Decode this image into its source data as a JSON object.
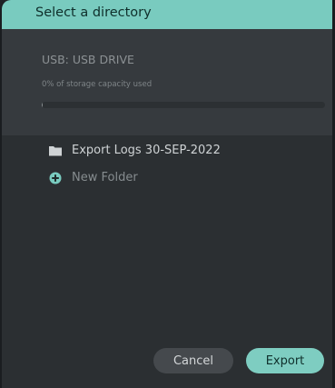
{
  "dialog": {
    "title": "Select a directory"
  },
  "storage": {
    "label": "USB: USB DRIVE",
    "usage_text": "0% of storage capacity used",
    "used_fraction": 0.0
  },
  "items": [
    {
      "label": "Export Logs 30-SEP-2022",
      "icon": "folder-icon"
    },
    {
      "label": "New Folder",
      "icon": "plus-circle-icon"
    }
  ],
  "buttons": {
    "cancel": "Cancel",
    "export": "Export"
  },
  "colors": {
    "accent": "#79cbbf",
    "background": "#2b2f32",
    "panel": "#363a3e"
  }
}
